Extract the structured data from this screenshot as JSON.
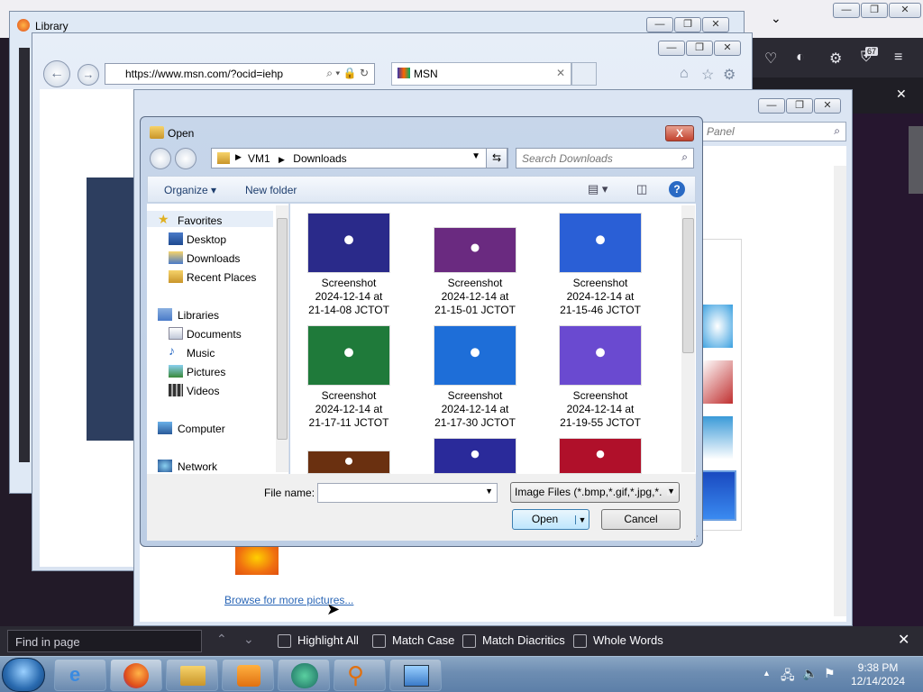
{
  "firefox": {
    "badge_count": "67",
    "find_bar": {
      "placeholder": "Find in page",
      "highlight_all": "Highlight All",
      "match_case": "Match Case",
      "match_diacritics": "Match Diacritics",
      "whole_words": "Whole Words"
    }
  },
  "library": {
    "title": "Library"
  },
  "ie": {
    "url": "https://www.msn.com/?ocid=iehp",
    "tab_title": "MSN"
  },
  "control_panel": {
    "search_placeholder": "Panel",
    "browse_link": "Browse for more pictures..."
  },
  "open_dialog": {
    "title": "Open",
    "close_label": "X",
    "path": [
      "VM1",
      "Downloads"
    ],
    "search_placeholder": "Search Downloads",
    "toolbar": {
      "organize": "Organize",
      "new_folder": "New folder"
    },
    "sidebar": {
      "favorites": {
        "header": "Favorites",
        "items": [
          "Desktop",
          "Downloads",
          "Recent Places"
        ]
      },
      "libraries": {
        "header": "Libraries",
        "items": [
          "Documents",
          "Music",
          "Pictures",
          "Videos"
        ]
      },
      "computer": "Computer",
      "network": "Network"
    },
    "files": [
      {
        "line1": "Screenshot",
        "line2": "2024-12-14 at",
        "line3": "21-14-08 JCTOT",
        "color": "#2a2a8a"
      },
      {
        "line1": "Screenshot",
        "line2": "2024-12-14 at",
        "line3": "21-15-01 JCTOT",
        "color": "#6a2a80"
      },
      {
        "line1": "Screenshot",
        "line2": "2024-12-14 at",
        "line3": "21-15-46 JCTOT",
        "color": "#2a5fd6"
      },
      {
        "line1": "Screenshot",
        "line2": "2024-12-14 at",
        "line3": "21-17-11 JCTOT",
        "color": "#1f7a3a"
      },
      {
        "line1": "Screenshot",
        "line2": "2024-12-14 at",
        "line3": "21-17-30 JCTOT",
        "color": "#1e6ed8"
      },
      {
        "line1": "Screenshot",
        "line2": "2024-12-14 at",
        "line3": "21-19-55 JCTOT",
        "color": "#6a4ad0"
      },
      {
        "line1": "",
        "line2": "",
        "line3": "",
        "color": "#6a3010"
      },
      {
        "line1": "",
        "line2": "",
        "line3": "",
        "color": "#2a2a9a"
      },
      {
        "line1": "",
        "line2": "",
        "line3": "",
        "color": "#b0102a"
      }
    ],
    "file_name_label": "File name:",
    "file_name_value": "",
    "file_type": "Image Files (*.bmp,*.gif,*.jpg,*.",
    "open_button": "Open",
    "cancel_button": "Cancel"
  },
  "taskbar": {
    "time": "9:38 PM",
    "date": "12/14/2024"
  }
}
